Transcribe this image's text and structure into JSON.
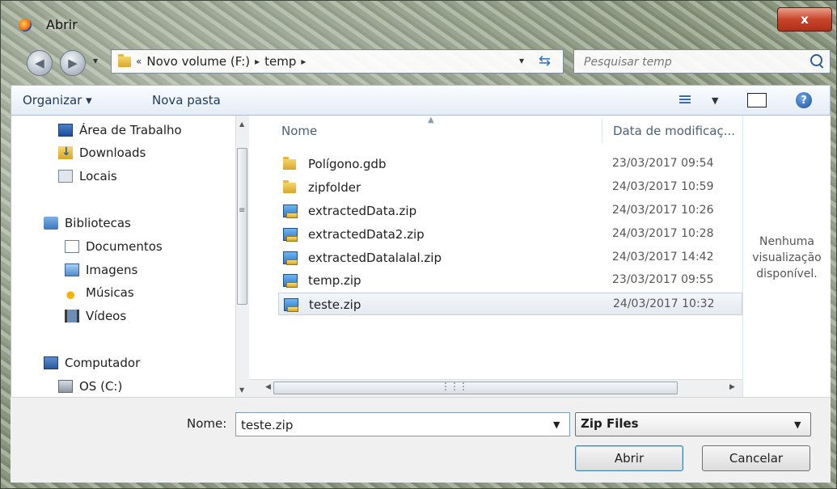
{
  "window": {
    "title": "Abrir",
    "close_label": "x"
  },
  "navigation": {
    "back_glyph": "◀",
    "forward_glyph": "▶",
    "breadcrumb_prefix": "«",
    "breadcrumbs": [
      "Novo volume (F:)",
      "temp"
    ],
    "search_placeholder": "Pesquisar temp"
  },
  "toolbar": {
    "organize_label": "Organizar ▾",
    "new_folder_label": "Nova pasta"
  },
  "sidebar": {
    "items": [
      {
        "label": "Área de Trabalho",
        "icon": "desktop-icon"
      },
      {
        "label": "Downloads",
        "icon": "downloads-folder-icon"
      },
      {
        "label": "Locais",
        "icon": "places-icon"
      },
      {
        "label": "Bibliotecas",
        "icon": "libraries-icon"
      },
      {
        "label": "Documentos",
        "icon": "documents-icon"
      },
      {
        "label": "Imagens",
        "icon": "images-icon"
      },
      {
        "label": "Músicas",
        "icon": "music-icon"
      },
      {
        "label": "Vídeos",
        "icon": "videos-icon"
      },
      {
        "label": "Computador",
        "icon": "computer-icon"
      },
      {
        "label": "OS (C:)",
        "icon": "drive-icon"
      }
    ]
  },
  "files": {
    "columns": {
      "name": "Nome",
      "date": "Data de modificaç..."
    },
    "rows": [
      {
        "name": "Polígono.gdb",
        "date": "23/03/2017 09:54",
        "type": "folder"
      },
      {
        "name": "zipfolder",
        "date": "24/03/2017 10:59",
        "type": "folder"
      },
      {
        "name": "extractedData.zip",
        "date": "24/03/2017 10:26",
        "type": "zip"
      },
      {
        "name": "extractedData2.zip",
        "date": "24/03/2017 10:28",
        "type": "zip"
      },
      {
        "name": "extractedDatalalal.zip",
        "date": "24/03/2017 14:42",
        "type": "zip"
      },
      {
        "name": "temp.zip",
        "date": "23/03/2017 09:55",
        "type": "zip"
      },
      {
        "name": "teste.zip",
        "date": "24/03/2017 10:32",
        "type": "zip",
        "selected": true
      }
    ]
  },
  "preview": {
    "line1": "Nenhuma",
    "line2": "visualização",
    "line3": "disponível."
  },
  "footer": {
    "name_label": "Nome:",
    "filename_value": "teste.zip",
    "file_type_value": "Zip Files",
    "open_label": "Abrir",
    "cancel_label": "Cancelar"
  }
}
